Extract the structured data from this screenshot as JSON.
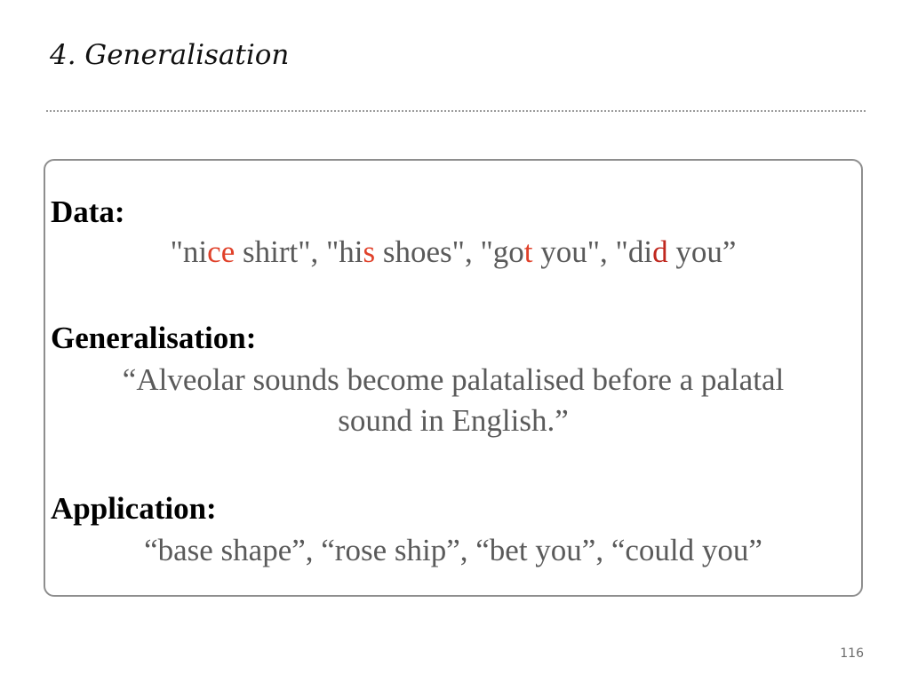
{
  "slide": {
    "title": "4. Generalisation",
    "page_number": "116"
  },
  "data_section": {
    "label": "Data:",
    "examples": [
      {
        "pre": "\"ni",
        "hl": "ce",
        "post": " shirt\", ",
        "hl_color": "#e0412a"
      },
      {
        "pre": "\"hi",
        "hl": "s",
        "post": " shoes\", ",
        "hl_color": "#e0412a"
      },
      {
        "pre": "\"go",
        "hl": "t",
        "post": " you\", ",
        "hl_color": "#e0412a"
      },
      {
        "pre": "\"di",
        "hl": "d",
        "post": " you”",
        "hl_color": "#c0281f"
      }
    ]
  },
  "generalisation_section": {
    "label": "Generalisation:",
    "line1": "“Alveolar sounds become palatalised before a palatal",
    "line2": "sound in English.”"
  },
  "application_section": {
    "label": "Application:",
    "text": "“base shape”, “rose ship”, “bet you”, “could you”"
  },
  "colors": {
    "highlight": "#e0412a",
    "highlight_dark": "#c0281f",
    "body_text": "#5a5a5a",
    "border": "#8e8e8e"
  }
}
